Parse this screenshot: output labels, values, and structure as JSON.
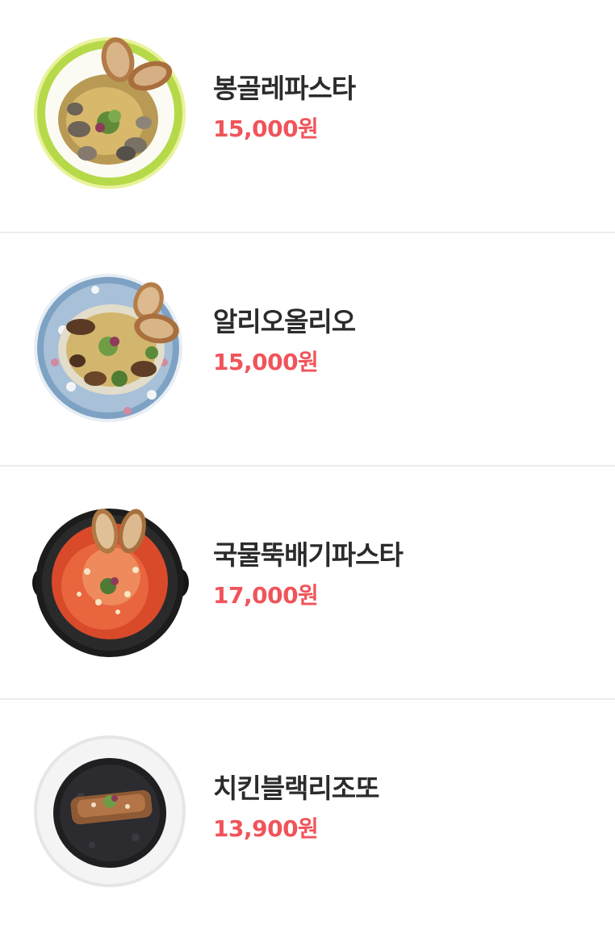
{
  "menu": {
    "items": [
      {
        "name": "봉골레파스타",
        "price": "15,000원",
        "image": "vongole-pasta-dish-image"
      },
      {
        "name": "알리오올리오",
        "price": "15,000원",
        "image": "aglio-olio-dish-image"
      },
      {
        "name": "국물뚝배기파스타",
        "price": "17,000원",
        "image": "earthenware-soup-pasta-dish-image"
      },
      {
        "name": "치킨블랙리조또",
        "price": "13,900원",
        "image": "chicken-black-risotto-dish-image"
      }
    ]
  },
  "colors": {
    "name_text": "#2b2b2b",
    "price_text": "#f0545a",
    "divider": "#ececec"
  }
}
